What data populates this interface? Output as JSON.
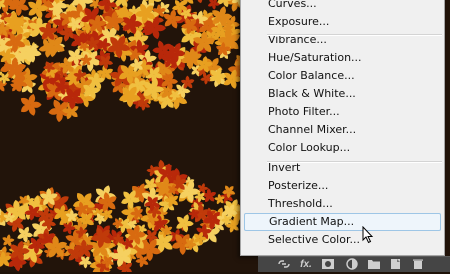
{
  "menu": {
    "items_top": [
      "Curves...",
      "Exposure..."
    ],
    "items_mid": [
      "Vibrance...",
      "Hue/Saturation...",
      "Color Balance...",
      "Black & White...",
      "Photo Filter...",
      "Channel Mixer...",
      "Color Lookup..."
    ],
    "items_bottom": [
      "Invert",
      "Posterize...",
      "Threshold...",
      "Gradient Map...",
      "Selective Color..."
    ],
    "hovered": "Gradient Map..."
  },
  "panel_bar": {
    "icons": [
      "link-icon",
      "fx-icon",
      "mask-icon",
      "adjustment-layer-icon",
      "folder-icon",
      "new-layer-icon",
      "trash-icon"
    ],
    "fx_label": "fx."
  },
  "colors": {
    "menu_bg": "#f0f0f0",
    "hover_bg": "#eef5fb",
    "hover_border": "#9ec6e6",
    "canvas_bg": "#1e1208",
    "panel_bar_bg": "#454545"
  }
}
